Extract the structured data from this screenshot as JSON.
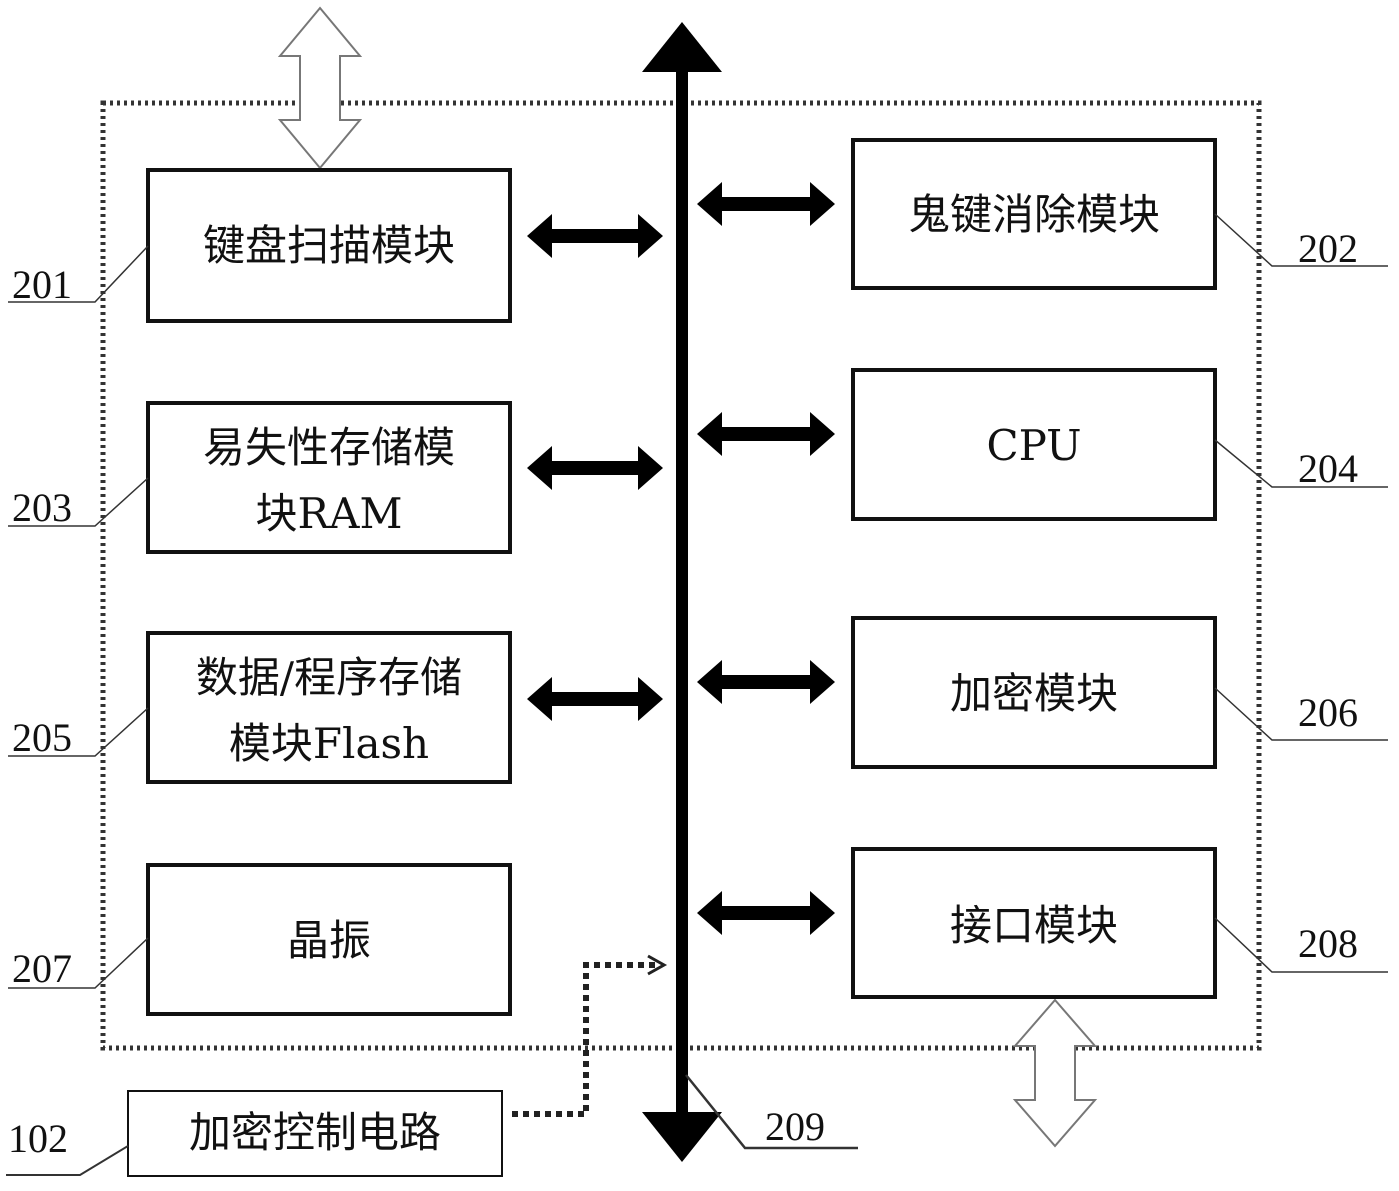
{
  "diagram": {
    "type": "block-diagram",
    "blocks": [
      {
        "id": "201",
        "lines": [
          "键盘扫描模块"
        ]
      },
      {
        "id": "202",
        "lines": [
          "鬼键消除模块"
        ]
      },
      {
        "id": "203",
        "lines": [
          "易失性存储模",
          "块RAM"
        ]
      },
      {
        "id": "204",
        "lines": [
          "CPU"
        ]
      },
      {
        "id": "205",
        "lines": [
          "数据/程序存储",
          "模块Flash"
        ]
      },
      {
        "id": "206",
        "lines": [
          "加密模块"
        ]
      },
      {
        "id": "207",
        "lines": [
          "晶振"
        ]
      },
      {
        "id": "208",
        "lines": [
          "接口模块"
        ]
      },
      {
        "id": "102",
        "lines": [
          "加密控制电路"
        ]
      }
    ],
    "bus": {
      "id": "209"
    },
    "refs": {
      "r201": "201",
      "r202": "202",
      "r203": "203",
      "r204": "204",
      "r205": "205",
      "r206": "206",
      "r207": "207",
      "r208": "208",
      "r209": "209",
      "r102": "102"
    },
    "connections": [
      {
        "from": "201",
        "to": "209",
        "style": "bidirectional"
      },
      {
        "from": "202",
        "to": "209",
        "style": "bidirectional"
      },
      {
        "from": "203",
        "to": "209",
        "style": "bidirectional"
      },
      {
        "from": "204",
        "to": "209",
        "style": "bidirectional"
      },
      {
        "from": "205",
        "to": "209",
        "style": "bidirectional"
      },
      {
        "from": "206",
        "to": "209",
        "style": "bidirectional"
      },
      {
        "from": "208",
        "to": "209",
        "style": "bidirectional"
      },
      {
        "from": "102",
        "to": "209",
        "style": "dotted"
      },
      {
        "from": "201",
        "to": "external",
        "style": "hollow-bidirectional"
      },
      {
        "from": "208",
        "to": "external",
        "style": "hollow-bidirectional"
      }
    ]
  }
}
